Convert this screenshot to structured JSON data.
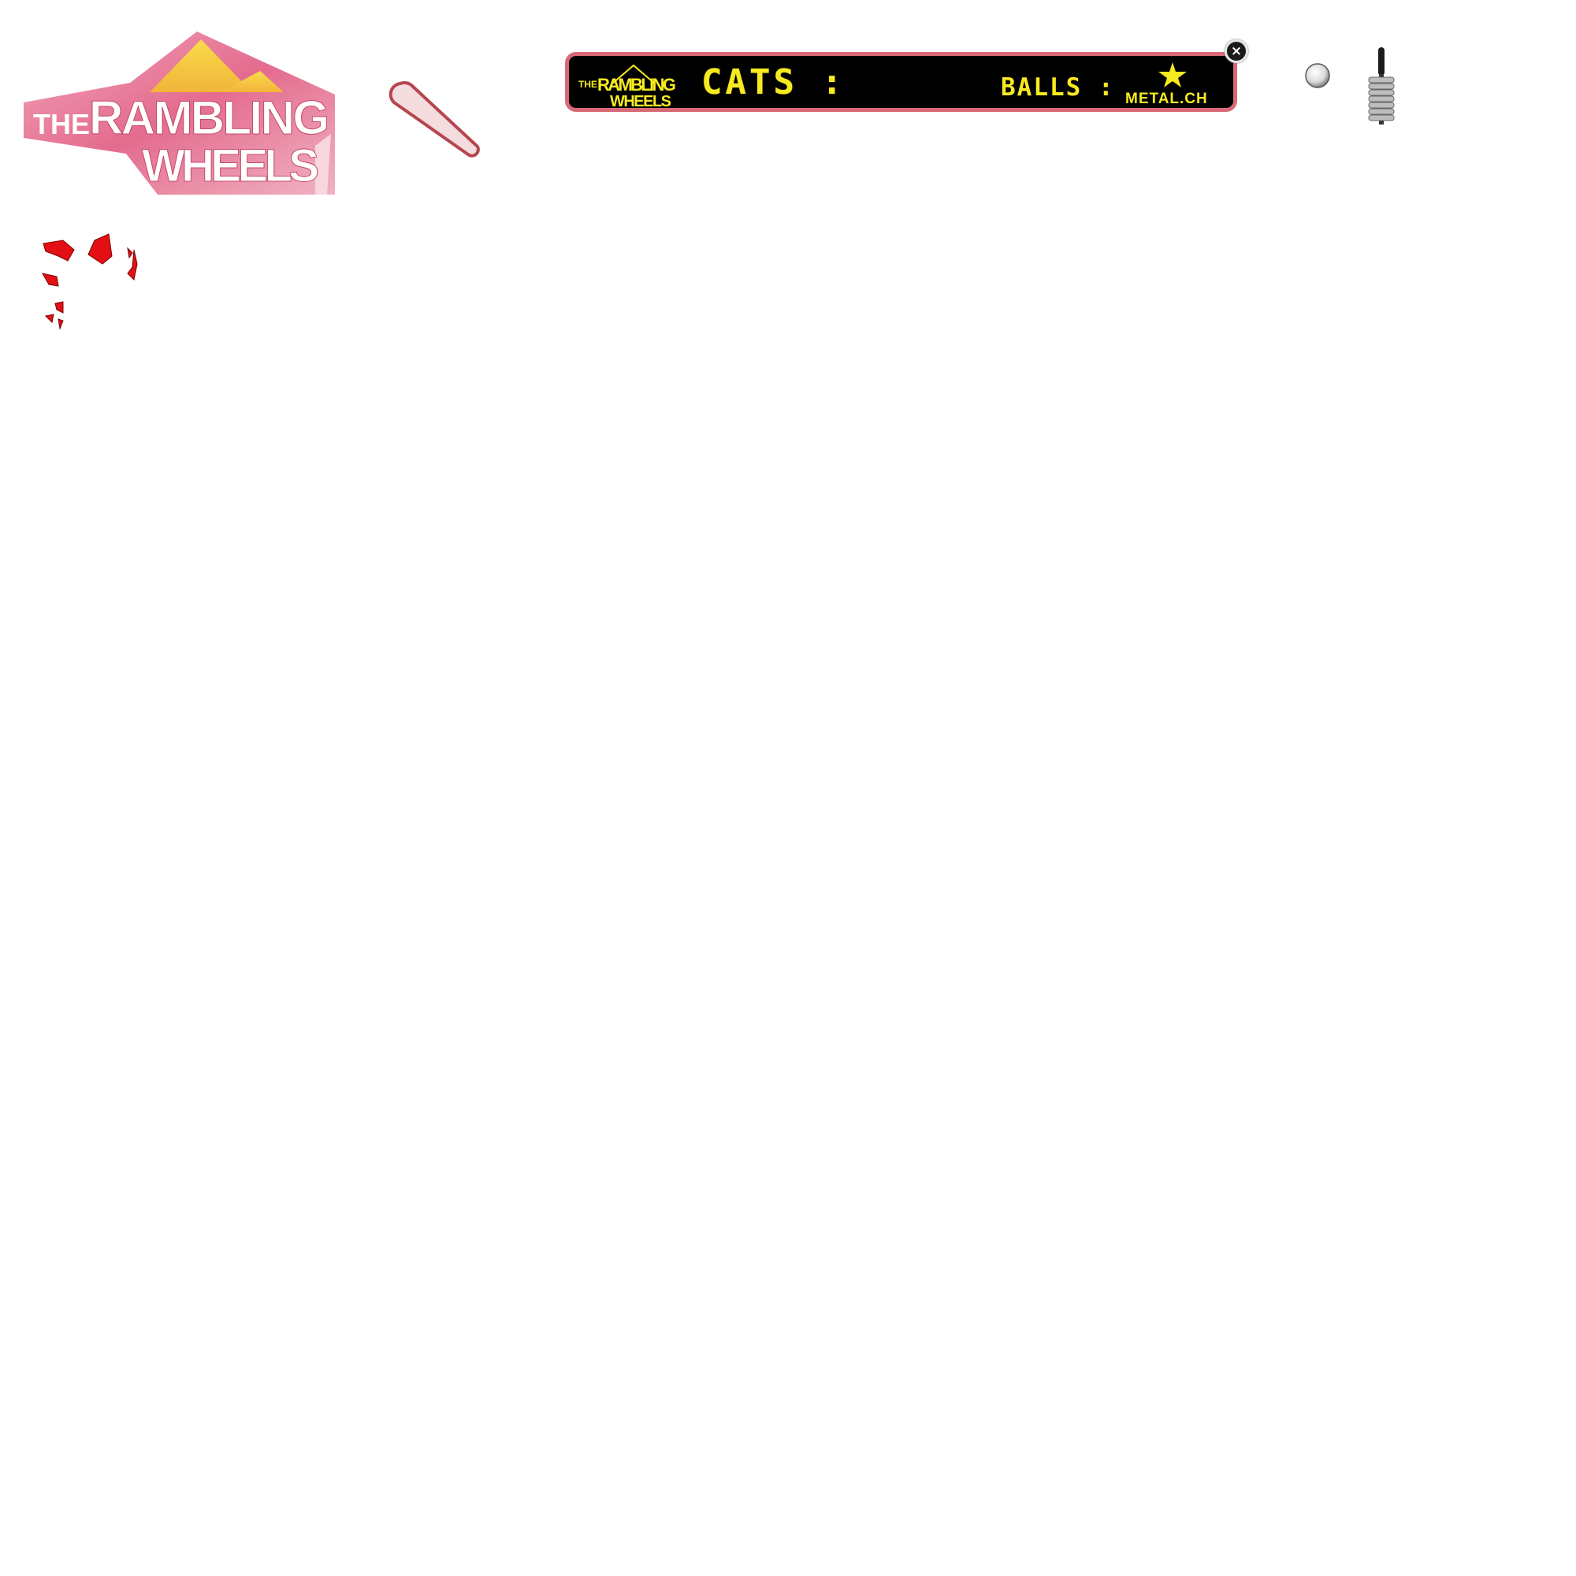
{
  "logo": {
    "line1": "THE RAMBLING",
    "line2": "WHEELS",
    "colors": {
      "pink": "#e8668a",
      "gold": "#f6c93a"
    }
  },
  "scoreboard": {
    "logo_line1": "THE RAMBLING",
    "logo_line2": "WHEELS",
    "cats_label": "CATS :",
    "balls_label": "BALLS :",
    "sponsor": "METAL.CH",
    "colors": {
      "frame": "#d86a78",
      "background": "#000000",
      "text": "#f6ea20"
    }
  },
  "close": {
    "label": "×",
    "icon": "close-icon"
  },
  "sprites": {
    "flipper": "flipper-icon",
    "ball": "pinball-icon",
    "plunger": "plunger-icon",
    "debris": "debris-icon"
  }
}
